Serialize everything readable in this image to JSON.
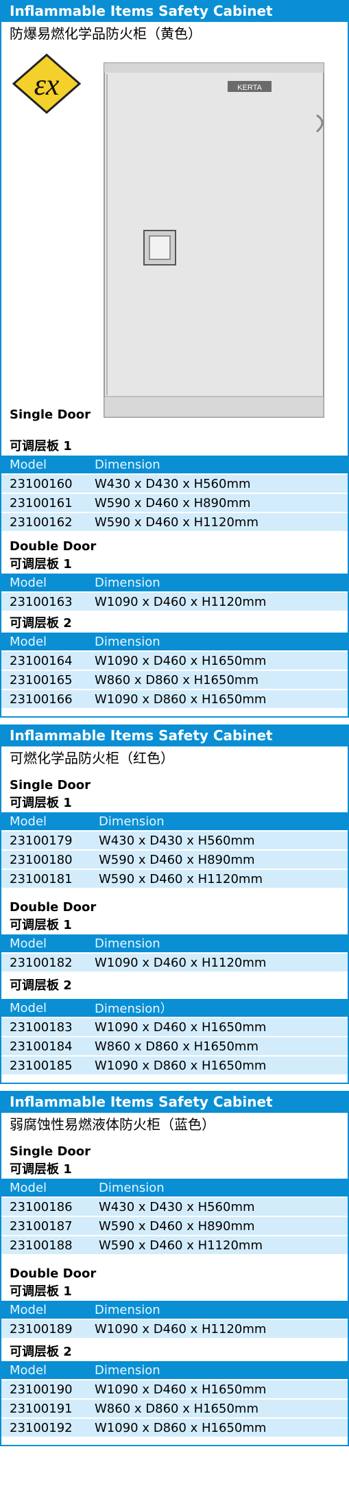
{
  "sections": [
    {
      "title": "Inflammable Items Safety Cabinet",
      "subtitle": "防爆易燃化学品防火柜（黄色）",
      "groups": [
        {
          "door": "Single Door",
          "shelf_label": "可调层板",
          "shelf_count": "1",
          "header": {
            "model": "Model",
            "dimension": "Dimension"
          },
          "rows": [
            {
              "model": "23100160",
              "dimension": "W430 x D430 x H560mm"
            },
            {
              "model": "23100161",
              "dimension": "W590 x D460 x H890mm"
            },
            {
              "model": "23100162",
              "dimension": "W590 x D460 x H1120mm"
            }
          ]
        },
        {
          "door": "Double Door",
          "shelf_label": "可调层板",
          "shelf_count": "1",
          "header": {
            "model": "Model",
            "dimension": "Dimension"
          },
          "rows": [
            {
              "model": "23100163",
              "dimension": "W1090 x D460 x H1120mm"
            }
          ]
        },
        {
          "shelf_label": "可调层板",
          "shelf_count": "2",
          "header": {
            "model": "Model",
            "dimension": "Dimension"
          },
          "rows": [
            {
              "model": "23100164",
              "dimension": "W1090 x D460 x H1650mm"
            },
            {
              "model": "23100165",
              "dimension": "W860 x D860 x H1650mm"
            },
            {
              "model": "23100166",
              "dimension": "W1090 x D860 x H1650mm"
            }
          ]
        }
      ]
    },
    {
      "title": "Inflammable Items Safety Cabinet",
      "subtitle": "可燃化学品防火柜（红色）",
      "groups": [
        {
          "door": "Single Door",
          "shelf_label": "可调层板",
          "shelf_count": "1",
          "header": {
            "model": "Model",
            "dimension": "Dimension"
          },
          "rows": [
            {
              "model": "23100179",
              "dimension": "W430 x D430 x H560mm"
            },
            {
              "model": "23100180",
              "dimension": "W590 x D460 x H890mm"
            },
            {
              "model": "23100181",
              "dimension": "W590 x D460 x H1120mm"
            }
          ]
        },
        {
          "door": "Double Door",
          "shelf_label": "可调层板",
          "shelf_count": "1",
          "header": {
            "model": "Model",
            "dimension": "Dimension"
          },
          "rows": [
            {
              "model": "23100182",
              "dimension": "W1090 x D460 x H1120mm"
            }
          ]
        },
        {
          "shelf_label": "可调层板",
          "shelf_count": "2",
          "header": {
            "model": "Model",
            "dimension": "Dimension）"
          },
          "rows": [
            {
              "model": "23100183",
              "dimension": "W1090 x D460 x H1650mm"
            },
            {
              "model": "23100184",
              "dimension": "W860 x D860 x H1650mm"
            },
            {
              "model": "23100185",
              "dimension": "W1090 x D860 x H1650mm"
            }
          ]
        }
      ]
    },
    {
      "title": "Inflammable Items Safety Cabinet",
      "subtitle": "弱腐蚀性易燃液体防火柜（蓝色）",
      "groups": [
        {
          "door": "Single Door",
          "shelf_label": "可调层板",
          "shelf_count": "1",
          "header": {
            "model": "Model",
            "dimension": "Dimension"
          },
          "rows": [
            {
              "model": "23100186",
              "dimension": "W430 x D430 x H560mm"
            },
            {
              "model": "23100187",
              "dimension": "W590 x D460 x H890mm"
            },
            {
              "model": "23100188",
              "dimension": "W590 x D460 x H1120mm"
            }
          ]
        },
        {
          "door": "Double Door",
          "shelf_label": "可调层板",
          "shelf_count": "1",
          "header": {
            "model": "Model",
            "dimension": "Dimension"
          },
          "rows": [
            {
              "model": "23100189",
              "dimension": "W1090 x D460 x H1120mm"
            }
          ]
        },
        {
          "shelf_label": "可调层板",
          "shelf_count": "2",
          "header": {
            "model": "Model",
            "dimension": "Dimension"
          },
          "rows": [
            {
              "model": "23100190",
              "dimension": "W1090 x D460 x H1650mm"
            },
            {
              "model": "23100191",
              "dimension": "W860 x D860 x H1650mm"
            },
            {
              "model": "23100192",
              "dimension": "W1090 x D860 x H1650mm"
            }
          ]
        }
      ]
    }
  ],
  "hero": {
    "badge_text": "KERTA",
    "ex_logo_color": "#f4d02a",
    "cabinet_color": "#e6e6e6"
  },
  "colors": {
    "accent": "#0a8fd4",
    "row_bg": "#d3ecfb"
  }
}
